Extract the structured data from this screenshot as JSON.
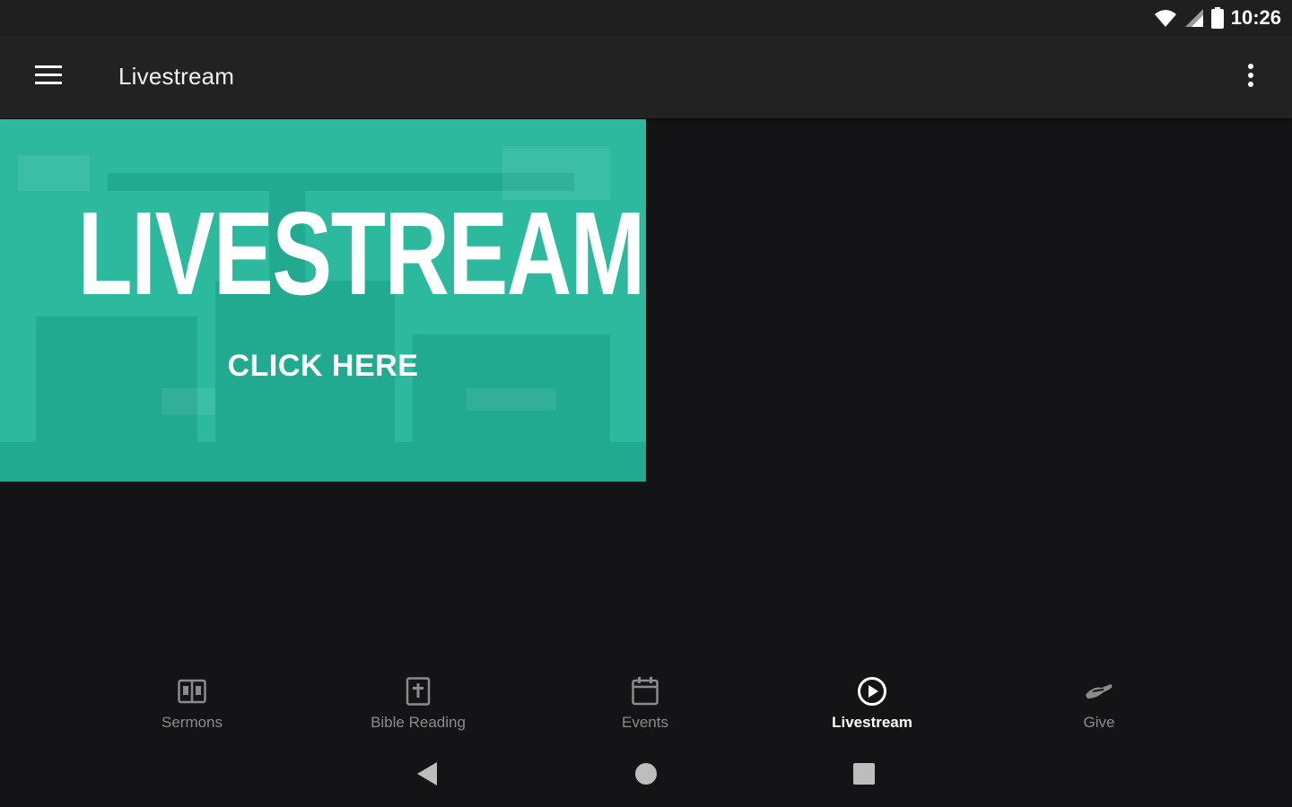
{
  "status_bar": {
    "time": "10:26"
  },
  "app_bar": {
    "title": "Livestream"
  },
  "banner": {
    "title": "LIVESTREAM",
    "cta": "CLICK HERE",
    "color": "#1fb598"
  },
  "bottom_nav": {
    "items": [
      {
        "label": "Sermons",
        "icon": "book-open-icon"
      },
      {
        "label": "Bible Reading",
        "icon": "bible-icon"
      },
      {
        "label": "Events",
        "icon": "calendar-icon"
      },
      {
        "label": "Livestream",
        "icon": "play-circle-icon",
        "active": true
      },
      {
        "label": "Give",
        "icon": "hand-give-icon"
      }
    ]
  },
  "colors": {
    "background": "#141416",
    "app_bar": "#222222",
    "inactive": "#8b8b8b",
    "active": "#ffffff"
  }
}
